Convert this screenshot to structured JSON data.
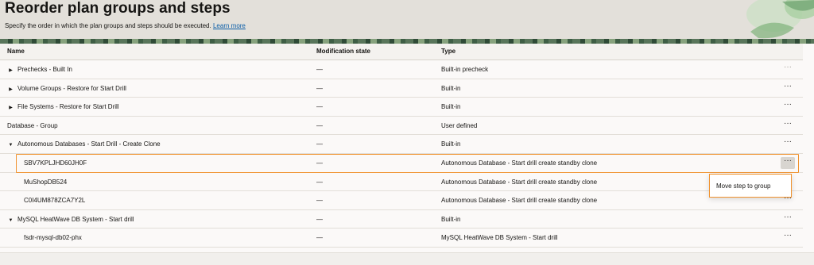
{
  "page": {
    "title": "Reorder plan groups and steps",
    "description": "Specify the order in which the plan groups and steps should be executed.",
    "learn_more": "Learn more"
  },
  "table": {
    "columns": [
      "Name",
      "Modification state",
      "Type"
    ],
    "rows": [
      {
        "name": "Prechecks - Built In",
        "mod": "—",
        "type": "Built-in precheck",
        "level": 1,
        "caret": "right",
        "more_dim": true
      },
      {
        "name": "Volume Groups - Restore for Start Drill",
        "mod": "—",
        "type": "Built-in",
        "level": 1,
        "caret": "right"
      },
      {
        "name": "File Systems - Restore for Start Drill",
        "mod": "—",
        "type": "Built-in",
        "level": 1,
        "caret": "right"
      },
      {
        "name": "Database - Group",
        "mod": "—",
        "type": "User defined",
        "level": 0
      },
      {
        "name": "Autonomous Databases - Start Drill - Create Clone",
        "mod": "—",
        "type": "Built-in",
        "level": 1,
        "caret": "down"
      },
      {
        "name": "SBV7KPLJHD60JH0F",
        "mod": "—",
        "type": "Autonomous Database - Start drill create standby clone",
        "level": 2,
        "active": true
      },
      {
        "name": "MuShopDB524",
        "mod": "—",
        "type": "Autonomous Database - Start drill create standby clone",
        "level": 2
      },
      {
        "name": "C0I4UM878ZCA7Y2L",
        "mod": "—",
        "type": "Autonomous Database - Start drill create standby clone",
        "level": 2
      },
      {
        "name": "MySQL HeatWave DB System - Start drill",
        "mod": "—",
        "type": "Built-in",
        "level": 1,
        "caret": "down"
      },
      {
        "name": "fsdr-mysql-db02-phx",
        "mod": "—",
        "type": "MySQL HeatWave DB System - Start drill",
        "level": 2
      }
    ]
  },
  "menu": {
    "move_step": "Move step to group"
  },
  "icons": {
    "more": "ellipsis-icon",
    "caret_right": "caret-right-icon",
    "caret_down": "caret-down-icon"
  },
  "colors": {
    "highlight": "#f0922e",
    "link": "#0b5ea8",
    "header_bg": "#e3e0da"
  }
}
